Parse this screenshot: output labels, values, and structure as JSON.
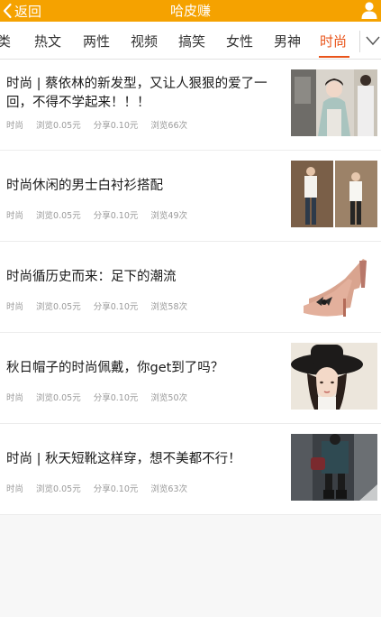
{
  "header": {
    "back_label": "返回",
    "title": "哈皮赚",
    "accent_color": "#f5a200"
  },
  "tabs": {
    "items": [
      "类",
      "热文",
      "两性",
      "视频",
      "搞笑",
      "女性",
      "男神",
      "时尚"
    ],
    "active": "时尚",
    "active_color": "#e9541a"
  },
  "articles": [
    {
      "title": "时尚 | 蔡依林的新发型，又让人狠狠的爱了一回，不得不学起来！！！",
      "category": "时尚",
      "view_reward": "浏览0.05元",
      "share_reward": "分享0.10元",
      "views": "浏览66次",
      "thumb_icon": "woman-street-photo"
    },
    {
      "title": "时尚休闲的男士白衬衫搭配",
      "category": "时尚",
      "view_reward": "浏览0.05元",
      "share_reward": "分享0.10元",
      "views": "浏览49次",
      "thumb_icon": "men-white-shirt-photo"
    },
    {
      "title": "时尚循历史而来：足下的潮流",
      "category": "时尚",
      "view_reward": "浏览0.05元",
      "share_reward": "分享0.10元",
      "views": "浏览58次",
      "thumb_icon": "high-heel-shoes-photo"
    },
    {
      "title": "秋日帽子的时尚佩戴，你get到了吗？",
      "category": "时尚",
      "view_reward": "浏览0.05元",
      "share_reward": "分享0.10元",
      "views": "浏览50次",
      "thumb_icon": "woman-hat-photo"
    },
    {
      "title": "时尚 | 秋天短靴这样穿，想不美都不行！",
      "category": "时尚",
      "view_reward": "浏览0.05元",
      "share_reward": "分享0.10元",
      "views": "浏览63次",
      "thumb_icon": "ankle-boots-photo"
    }
  ]
}
